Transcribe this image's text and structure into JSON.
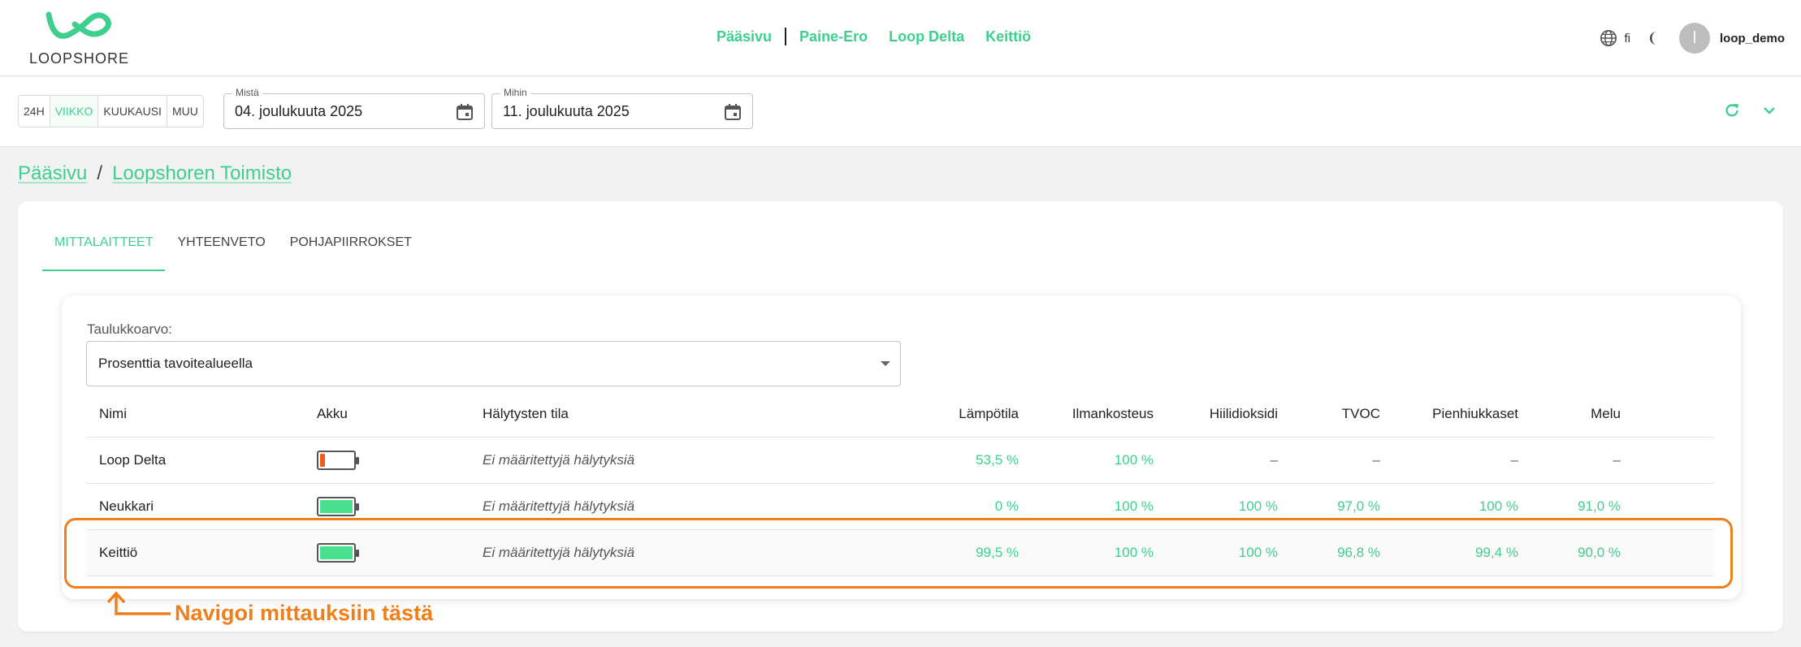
{
  "header": {
    "logo_text": "LOOPSHORE",
    "nav": [
      "Pääsivu",
      "Paine-Ero",
      "Loop Delta",
      "Keittiö"
    ],
    "language": "fi",
    "avatar_initial": "l",
    "username": "loop_demo"
  },
  "toolbar": {
    "ranges": [
      "24H",
      "VIIKKO",
      "KUUKAUSI",
      "MUU"
    ],
    "active_range": "VIIKKO",
    "from_label": "Mistä",
    "from_value": "04. joulukuuta 2025",
    "to_label": "Mihin",
    "to_value": "11. joulukuuta 2025"
  },
  "breadcrumb": [
    "Pääsivu",
    "Loopshoren Toimisto"
  ],
  "tabs": [
    "MITTALAITTEET",
    "YHTEENVETO",
    "POHJAPIIRROKSET"
  ],
  "active_tab": "MITTALAITTEET",
  "table_value": {
    "label": "Taulukkoarvo:",
    "selected": "Prosenttia tavoitealueella"
  },
  "table": {
    "headers": [
      "Nimi",
      "Akku",
      "Hälytysten tila",
      "Lämpötila",
      "Ilmankosteus",
      "Hiilidioksidi",
      "TVOC",
      "Pienhiukkaset",
      "Melu"
    ],
    "rows": [
      {
        "name": "Loop Delta",
        "battery_level": 0.15,
        "battery_color": "#f05a1a",
        "alarm": "Ei määritettyjä hälytyksiä",
        "values": [
          "53,5 %",
          "100 %",
          "–",
          "–",
          "–",
          "–"
        ]
      },
      {
        "name": "Neukkari",
        "battery_level": 1.0,
        "battery_color": "#4be08f",
        "alarm": "Ei määritettyjä hälytyksiä",
        "values": [
          "0 %",
          "100 %",
          "100 %",
          "97,0 %",
          "100 %",
          "91,0 %"
        ]
      },
      {
        "name": "Keittiö",
        "battery_level": 1.0,
        "battery_color": "#4be08f",
        "alarm": "Ei määritettyjä hälytyksiä",
        "values": [
          "99,5 %",
          "100 %",
          "100 %",
          "96,8 %",
          "99,4 %",
          "90,0 %"
        ]
      }
    ]
  },
  "annotation": {
    "text": "Navigoi mittauksiin tästä",
    "color": "#ef7f1a"
  },
  "colors": {
    "accent": "#3ecf8e",
    "annotation": "#ef7f1a"
  }
}
